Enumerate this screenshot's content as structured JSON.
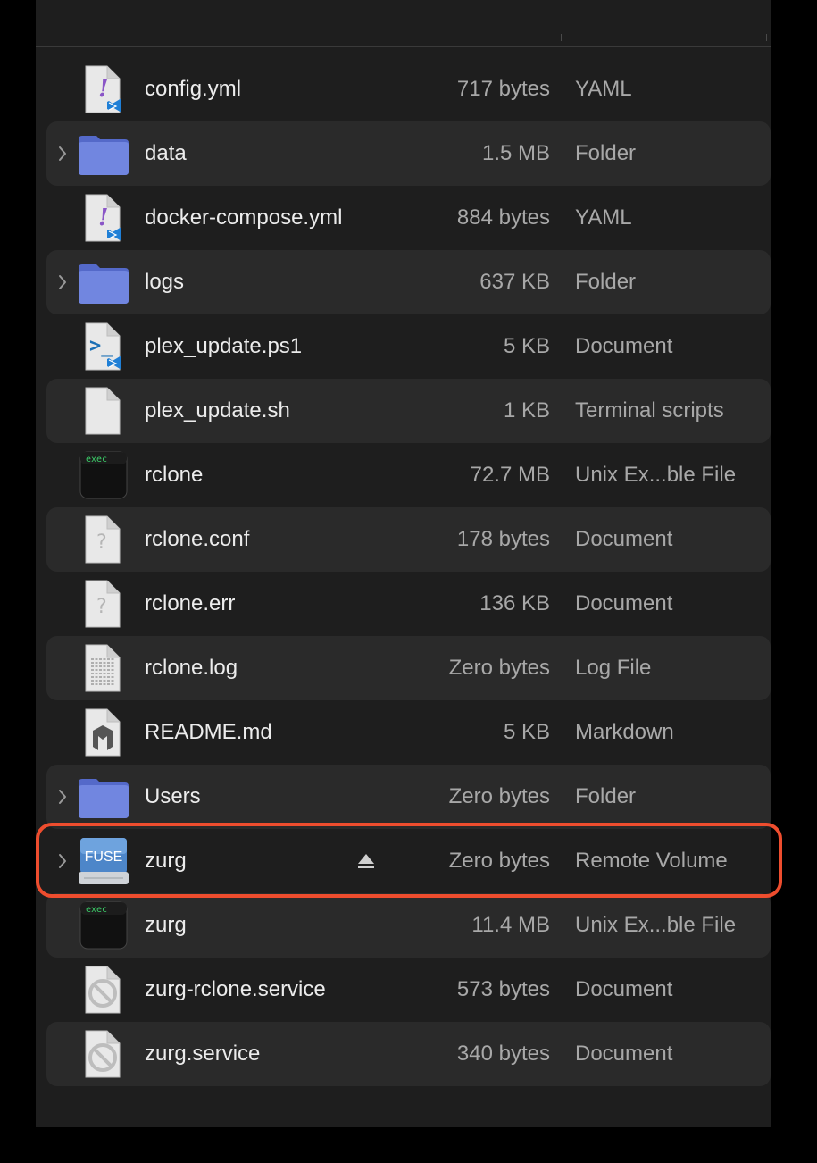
{
  "files": [
    {
      "name": "config.yml",
      "size": "717 bytes",
      "kind": "YAML",
      "icon": "yaml-file-icon",
      "folder": false,
      "alt": false
    },
    {
      "name": "data",
      "size": "1.5 MB",
      "kind": "Folder",
      "icon": "folder-icon",
      "folder": true,
      "alt": true
    },
    {
      "name": "docker-compose.yml",
      "size": "884 bytes",
      "kind": "YAML",
      "icon": "yaml-file-icon",
      "folder": false,
      "alt": false
    },
    {
      "name": "logs",
      "size": "637 KB",
      "kind": "Folder",
      "icon": "folder-icon",
      "folder": true,
      "alt": true
    },
    {
      "name": "plex_update.ps1",
      "size": "5 KB",
      "kind": "Document",
      "icon": "powershell-file-icon",
      "folder": false,
      "alt": false
    },
    {
      "name": "plex_update.sh",
      "size": "1 KB",
      "kind": "Terminal scripts",
      "icon": "blank-file-icon",
      "folder": false,
      "alt": true
    },
    {
      "name": "rclone",
      "size": "72.7 MB",
      "kind": "Unix Ex...ble File",
      "icon": "exec-file-icon",
      "folder": false,
      "alt": false
    },
    {
      "name": "rclone.conf",
      "size": "178 bytes",
      "kind": "Document",
      "icon": "unknown-file-icon",
      "folder": false,
      "alt": true
    },
    {
      "name": "rclone.err",
      "size": "136 KB",
      "kind": "Document",
      "icon": "unknown-file-icon",
      "folder": false,
      "alt": false
    },
    {
      "name": "rclone.log",
      "size": "Zero bytes",
      "kind": "Log File",
      "icon": "log-file-icon",
      "folder": false,
      "alt": true
    },
    {
      "name": "README.md",
      "size": "5 KB",
      "kind": "Markdown",
      "icon": "markdown-file-icon",
      "folder": false,
      "alt": false
    },
    {
      "name": "Users",
      "size": "Zero bytes",
      "kind": "Folder",
      "icon": "folder-icon",
      "folder": true,
      "alt": true
    },
    {
      "name": "zurg",
      "size": "Zero bytes",
      "kind": "Remote Volume",
      "icon": "fuse-volume-icon",
      "folder": true,
      "alt": false,
      "eject": true
    },
    {
      "name": "zurg",
      "size": "11.4 MB",
      "kind": "Unix Ex...ble File",
      "icon": "exec-file-icon",
      "folder": false,
      "alt": true
    },
    {
      "name": "zurg-rclone.service",
      "size": "573 bytes",
      "kind": "Document",
      "icon": "prohibited-file-icon",
      "folder": false,
      "alt": false
    },
    {
      "name": "zurg.service",
      "size": "340 bytes",
      "kind": "Document",
      "icon": "prohibited-file-icon",
      "folder": false,
      "alt": true
    }
  ],
  "icon_labels": {
    "exec": "exec",
    "fuse": "FUSE",
    "yaml_mark": "!",
    "unknown_mark": "?"
  },
  "colors": {
    "highlight": "#ee4d2e",
    "folder": "#6c7fd6",
    "background": "#1e1e1e",
    "alt_row": "#2a2a2a"
  }
}
